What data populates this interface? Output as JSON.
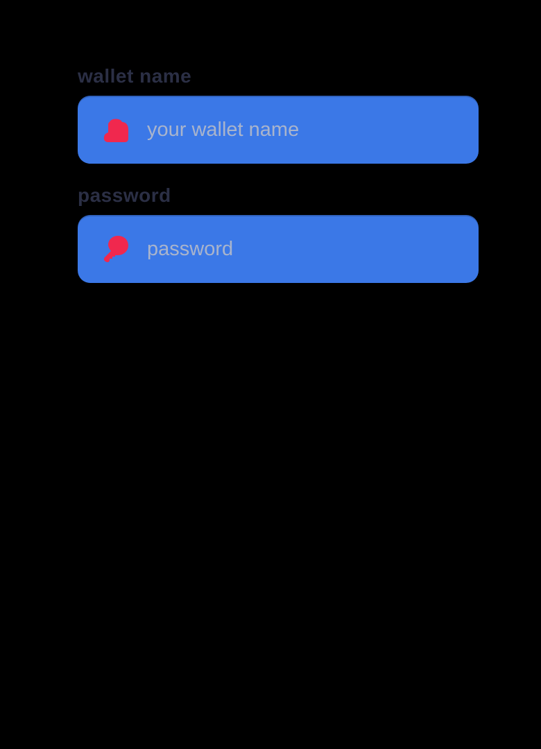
{
  "colors": {
    "background": "#000000",
    "label_text": "#2b2f45",
    "input_background": "#3b78e7",
    "placeholder_text": "#a9b4cc",
    "icon_accent": "#f0284e"
  },
  "form": {
    "wallet_name": {
      "label": "wallet name",
      "placeholder": "your wallet name",
      "value": "",
      "icon": "wallet-icon"
    },
    "password": {
      "label": "password",
      "placeholder": "password",
      "value": "",
      "icon": "key-icon"
    }
  }
}
